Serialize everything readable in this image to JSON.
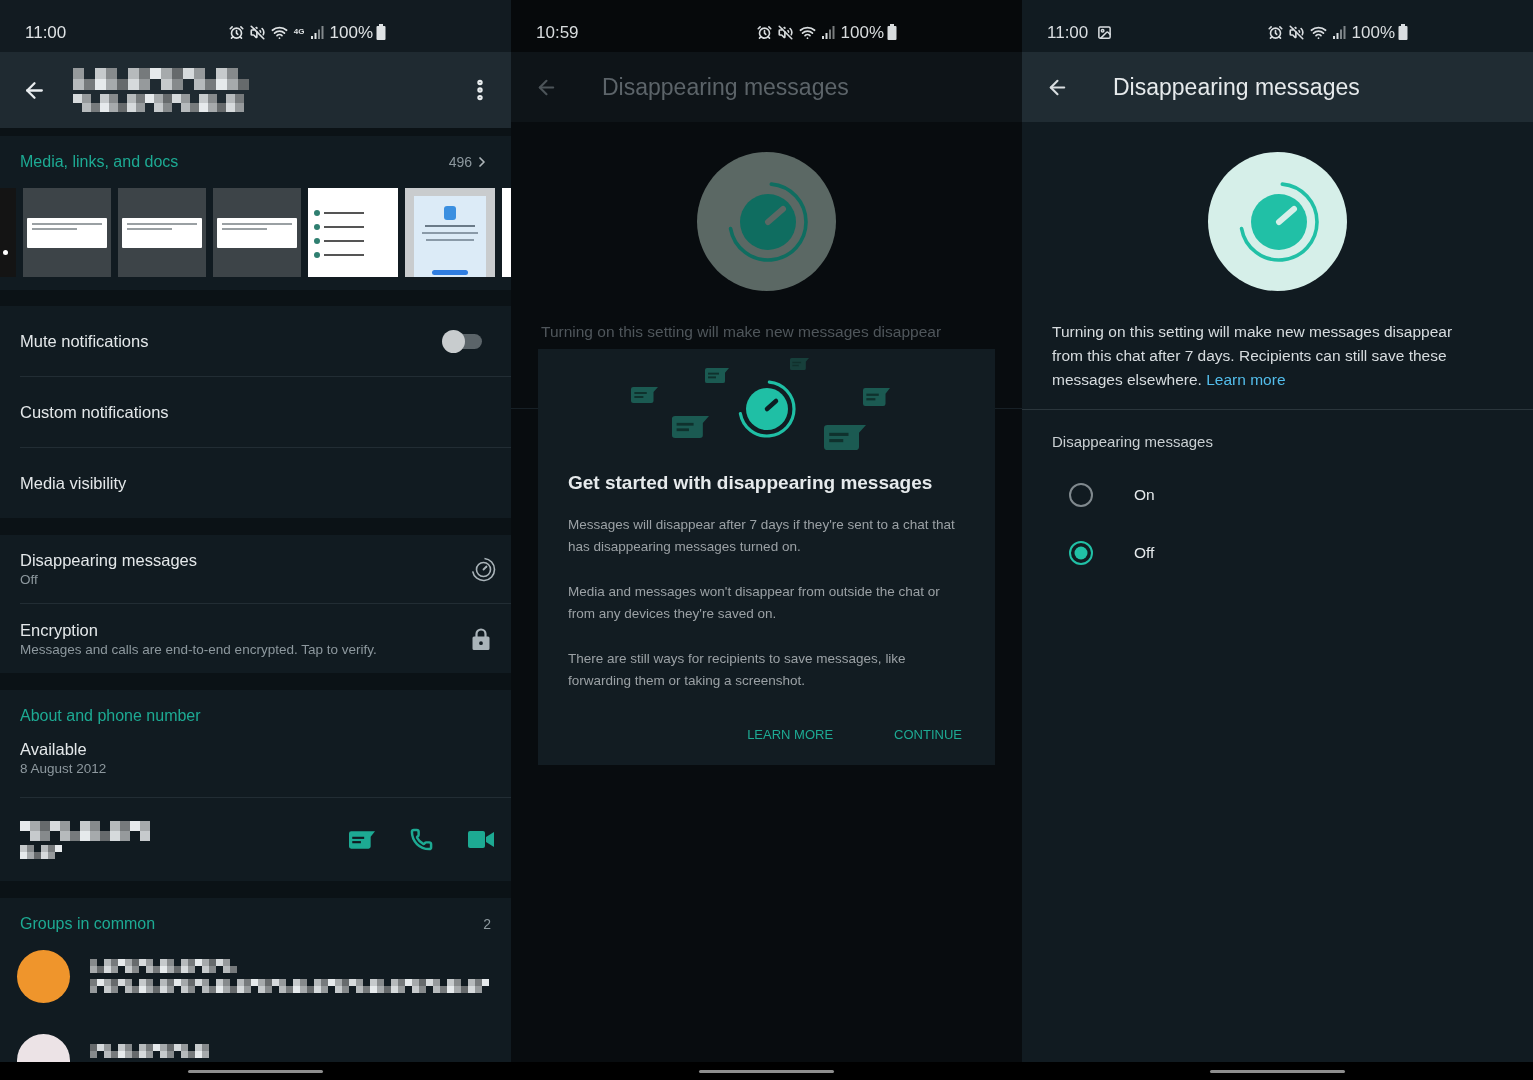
{
  "contact_info": {
    "status_bar": {
      "time": "11:00",
      "network_label": "4G",
      "battery": "100%"
    },
    "media": {
      "title": "Media, links, and docs",
      "count": "496"
    },
    "settings": [
      {
        "kind": "toggle",
        "label": "Mute notifications",
        "on": false
      },
      {
        "kind": "plain",
        "label": "Custom notifications"
      },
      {
        "kind": "plain",
        "label": "Media visibility"
      }
    ],
    "privacy": [
      {
        "kind": "timer",
        "label": "Disappearing messages",
        "sublabel": "Off"
      },
      {
        "kind": "lock",
        "label": "Encryption",
        "sublabel": "Messages and calls are end-to-end encrypted. Tap to verify."
      }
    ],
    "about": {
      "title": "About and phone number",
      "status": "Available",
      "date": "8 August 2012"
    },
    "groups": {
      "title": "Groups in common",
      "count": "2"
    }
  },
  "intro_screen": {
    "status_bar": {
      "time": "10:59",
      "battery": "100%"
    },
    "title": "Disappearing messages",
    "description": "Turning on this setting will make new messages disappear",
    "dialog": {
      "title": "Get started with disappearing messages",
      "paragraphs": [
        "Messages will disappear after 7 days if they're sent to a chat that has disappearing messages turned on.",
        "Media and messages won't disappear from outside the chat or from any devices they're saved on.",
        "There are still ways for recipients to save messages, like forwarding them or taking a screenshot."
      ],
      "buttons": [
        "LEARN MORE",
        "CONTINUE"
      ]
    }
  },
  "settings_screen": {
    "status_bar": {
      "time": "11:00",
      "battery": "100%"
    },
    "title": "Disappearing messages",
    "description": "Turning on this setting will make new messages disappear from this chat after 7 days. Recipients can still save these messages elsewhere.",
    "link": "Learn more",
    "options_label": "Disappearing messages",
    "options": [
      {
        "label": "On",
        "selected": false
      },
      {
        "label": "Off",
        "selected": true
      }
    ]
  }
}
